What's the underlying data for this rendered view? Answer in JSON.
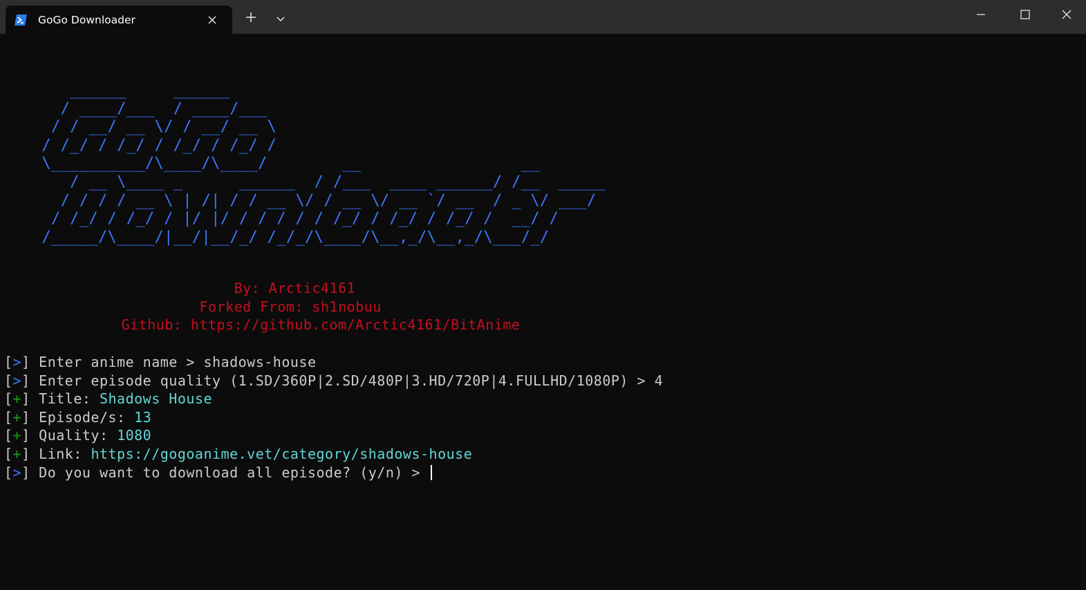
{
  "window": {
    "tab_title": "GoGo Downloader",
    "colors": {
      "titlebar": "#2d2d2d",
      "background": "#0c0c0c",
      "banner": "#3b78ff",
      "credits": "#c50f1f",
      "prompt_marker": "#3b78ff",
      "info_marker": "#13a10e",
      "value": "#61d6d6",
      "text": "#cccccc"
    },
    "icons": {
      "tab": "powershell-icon",
      "tab_close": "close-icon",
      "new_tab": "plus-icon",
      "dropdown": "chevron-down-icon",
      "minimize": "minimize-icon",
      "maximize": "maximize-icon",
      "close": "close-icon"
    }
  },
  "banner": {
    "ascii_lines": [
      "       ______     ______",
      "      / ____/___  / ____/___",
      "     / / __/ __ \\/ / __/ __ \\",
      "    / /_/ / /_/ / /_/ / /_/ /",
      "    \\__________/\\____/\\____/        __                 __",
      "       / __ \\____ _      ______  / /___  ____ ______/ /__  _____",
      "      / / / / __ \\ | /| / / __ \\/ / __ \\/ __ `/ __  / _ \\/ ___/",
      "     / /_/ / /_/ / |/ |/ / / / / / /_/ / /_/ / /_/ /  __/ /",
      "    /_____/\\____/|__/|__/_/ /_/_/\\____/\\__,_/\\__,_/\\___/_/"
    ]
  },
  "credits": {
    "by": "                           By: Arctic4161",
    "forked": "                       Forked From: sh1nobuu",
    "github": "              Github: https://github.com/Arctic4161/BitAnime"
  },
  "console": {
    "lines": [
      {
        "open": "[",
        "marker": ">",
        "close": "]",
        "marker_type": "prompt",
        "text": " Enter anime name > shadows-house",
        "value": ""
      },
      {
        "open": "[",
        "marker": ">",
        "close": "]",
        "marker_type": "prompt",
        "text": " Enter episode quality (1.SD/360P|2.SD/480P|3.HD/720P|4.FULLHD/1080P) > 4",
        "value": ""
      },
      {
        "open": "[",
        "marker": "+",
        "close": "]",
        "marker_type": "info",
        "text": " Title: ",
        "value": "Shadows House"
      },
      {
        "open": "[",
        "marker": "+",
        "close": "]",
        "marker_type": "info",
        "text": " Episode/s: ",
        "value": "13"
      },
      {
        "open": "[",
        "marker": "+",
        "close": "]",
        "marker_type": "info",
        "text": " Quality: ",
        "value": "1080"
      },
      {
        "open": "[",
        "marker": "+",
        "close": "]",
        "marker_type": "info",
        "text": " Link: ",
        "value": "https://gogoanime.vet/category/shadows-house"
      },
      {
        "open": "[",
        "marker": ">",
        "close": "]",
        "marker_type": "prompt",
        "text": " Do you want to download all episode? (y/n) > ",
        "value": ""
      }
    ]
  }
}
